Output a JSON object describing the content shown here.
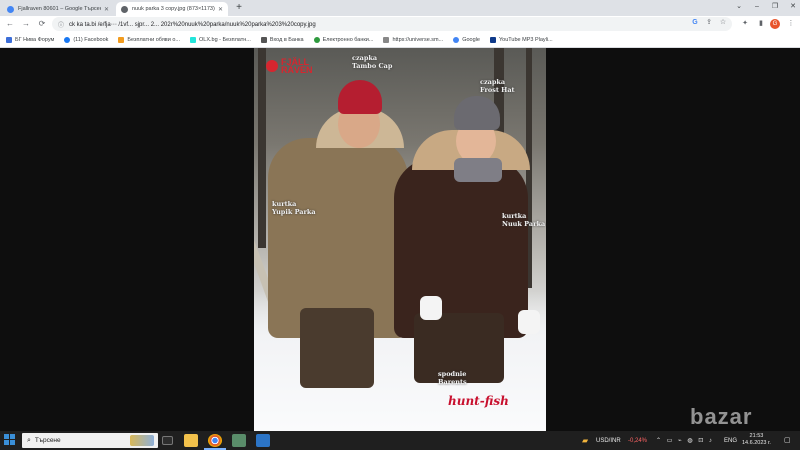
{
  "browser": {
    "tabs": [
      {
        "label": "Fjallraven 80601 – Google Търсене",
        "favicon_color": "#4285f4",
        "active": false
      },
      {
        "label": "nuuk parka 3 copy.jpg (873×1173)",
        "favicon_color": "#5f6368",
        "active": true
      }
    ],
    "new_tab": "+",
    "window_controls": {
      "tab_list": "⌄",
      "minimize": "–",
      "maximize": "❐",
      "close": "✕"
    },
    "nav": {
      "back": "←",
      "forward": "→",
      "reload": "⟳"
    },
    "address": {
      "info": "ⓘ",
      "url": "ck ka ta.bi /e/fja⋯ /1vf... sjpr... 2... 202r%20nuuk%20parka/nuuk%20parka%203%20copy.jpg"
    },
    "omni_icons": {
      "google": "G",
      "share": "⇪",
      "star": "☆"
    },
    "toolbar_icons": {
      "extensions": "✦",
      "sidebar": "▮",
      "profile": "G",
      "menu": "⋮"
    },
    "bookmarks": [
      {
        "label": "БГ Нива Форум",
        "color": "#3c6ed8"
      },
      {
        "label": "(11) Facebook",
        "color": "#1877f2"
      },
      {
        "label": "Безплатни обяви о...",
        "color": "#f29c1f"
      },
      {
        "label": "OLX.bg - Безплатн...",
        "color": "#23e5db"
      },
      {
        "label": "Вход в Банка",
        "color": "#555555"
      },
      {
        "label": "Електронно банки...",
        "color": "#2e9a3e"
      },
      {
        "label": "https://universe.sm...",
        "color": "#888888"
      },
      {
        "label": "Google",
        "color": "#4285f4"
      },
      {
        "label": "YouTube MP3 Playli...",
        "color": "#0f3a8a"
      }
    ]
  },
  "image": {
    "logo": "FJÄLL RÄVEN",
    "labels": {
      "czapka_1": "czapka\nTambo Cap",
      "czapka_2": "czapka\nFrost Hat",
      "kurtka_1": "kurtka\nYupik Parka",
      "kurtka_2": "kurtka\nNuuk Parka",
      "spodnie": "spodnie\nBarents"
    },
    "watermark": "hunt-fish",
    "site_watermark": "bazar"
  },
  "taskbar": {
    "search_placeholder": "Търсене",
    "search_icon": "⌕",
    "fx_icon": "▰",
    "fx_label": "USD/INR",
    "fx_change": "-0,24%",
    "tray_icons": "⌃ ▭ ⌁ ◍ ⊡ ♪",
    "language": "ENG",
    "time": "21:53",
    "date": "14.6.2023 г.",
    "notification_icon": "▢"
  }
}
